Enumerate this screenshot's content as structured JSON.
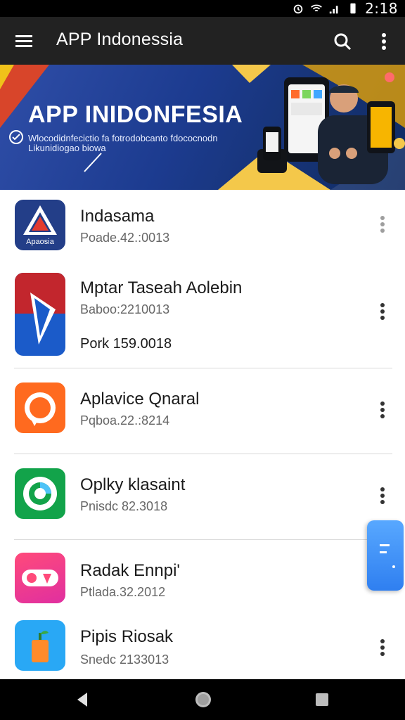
{
  "status_bar": {
    "time": "2:18",
    "icons": [
      "alarm-icon",
      "wifi-icon",
      "signal-icon",
      "battery-icon"
    ]
  },
  "app_bar": {
    "title": "APP Indonessia",
    "menu_icon": "hamburger-menu-icon",
    "search_icon": "search-icon",
    "more_icon": "more-vert-icon"
  },
  "banner": {
    "title": "APP INIDONFESIA",
    "subtitle": "Wlocodidnfecictio fa fotrodobcanto fdococnodn Likunidiogao biowa"
  },
  "apps": [
    {
      "name": "Indasama",
      "meta": "Poade.42.:0013",
      "extra": "",
      "icon": "A"
    },
    {
      "name": "Mptar Taseah Aolebin",
      "meta": "Baboo:2210013",
      "extra": "Pork 159.0018",
      "icon": "play"
    },
    {
      "name": "Aplavice Qnaral",
      "meta": "Pqboa.22.:8214",
      "extra": "",
      "icon": "chat"
    },
    {
      "name": "Oplky klasaint",
      "meta": "Pnisdc 82.3018",
      "extra": "",
      "icon": "donut"
    },
    {
      "name": "Radak Ennpi'",
      "meta": "Ptlada.32.2012",
      "extra": "",
      "icon": "toggle"
    },
    {
      "name": "Pipis Riosak",
      "meta": "Snedc 2133013",
      "extra": "",
      "icon": "box"
    }
  ],
  "colors": {
    "appbar": "#222222",
    "banner": "#1c3b8f",
    "divider": "#d9d9d9",
    "fab": "#2f7ff0"
  },
  "nav_bar": {
    "back_icon": "back-triangle-icon",
    "home_icon": "home-circle-icon",
    "recents_icon": "recents-square-icon"
  }
}
